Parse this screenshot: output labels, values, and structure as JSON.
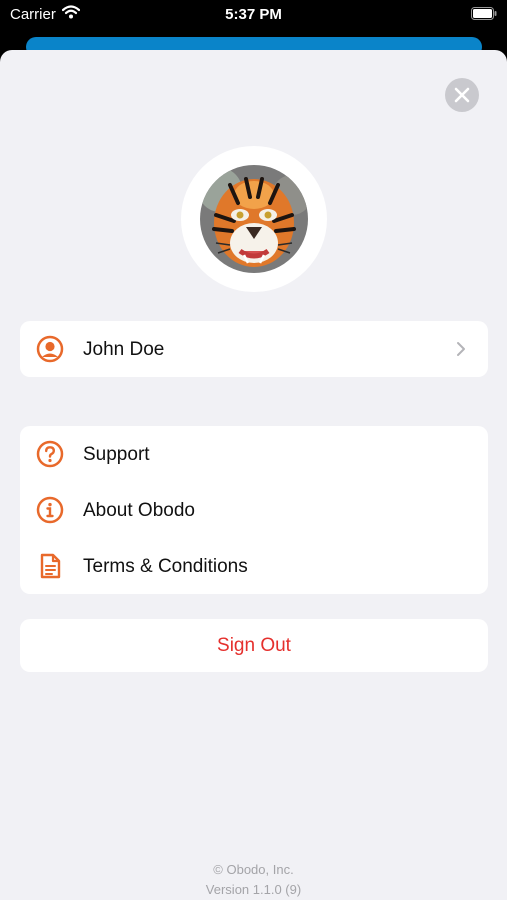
{
  "status_bar": {
    "carrier": "Carrier",
    "time": "5:37 PM",
    "wifi_icon": "wifi-icon",
    "battery_icon": "battery-icon"
  },
  "colors": {
    "accent": "#E8692B",
    "signout": "#E5302D",
    "sheet_background": "#F1F1F5",
    "top_bar": "#0A84C9"
  },
  "sheet": {
    "close_icon": "close-icon",
    "avatar": {
      "description": "tiger-face-photo"
    },
    "profile": {
      "name": "John Doe",
      "icon": "user-circle-icon",
      "chevron": "chevron-right-icon"
    },
    "menu": [
      {
        "label": "Support",
        "icon": "question-circle-icon"
      },
      {
        "label": "About Obodo",
        "icon": "info-circle-icon"
      },
      {
        "label": "Terms & Conditions",
        "icon": "document-icon"
      }
    ],
    "sign_out": "Sign Out"
  },
  "footer": {
    "copyright": "© Obodo, Inc.",
    "version": "Version 1.1.0 (9)"
  }
}
